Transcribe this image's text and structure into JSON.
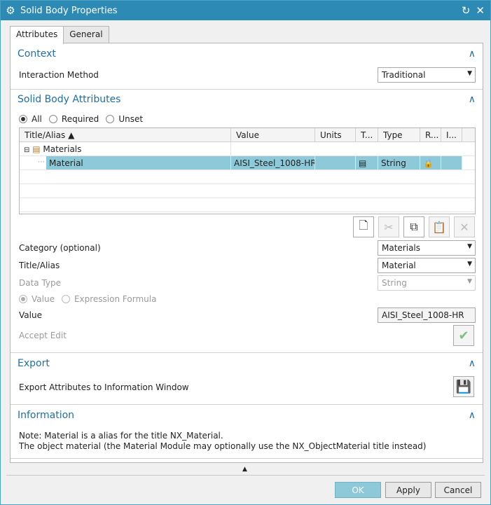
{
  "window": {
    "title": "Solid Body Properties"
  },
  "tabs": [
    {
      "label": "Attributes"
    },
    {
      "label": "General"
    }
  ],
  "context": {
    "header": "Context",
    "interaction_label": "Interaction Method",
    "interaction_value": "Traditional"
  },
  "attributes": {
    "header": "Solid Body Attributes",
    "filter": {
      "all": "All",
      "required": "Required",
      "unset": "Unset",
      "selected": "All"
    },
    "table": {
      "columns": [
        "Title/Alias",
        "Value",
        "Units",
        "T...",
        "Type",
        "R...",
        "I..."
      ],
      "group": "Materials",
      "row": {
        "title": "Material",
        "value": "AISI_Steel_1008-HR",
        "units": "",
        "type": "String"
      }
    },
    "category_label": "Category (optional)",
    "category_value": "Materials",
    "title_label": "Title/Alias",
    "title_value": "Material",
    "datatype_label": "Data Type",
    "datatype_value": "String",
    "mode": {
      "value": "Value",
      "formula": "Expression Formula"
    },
    "value_label": "Value",
    "value_value": "AISI_Steel_1008-HR",
    "accept_label": "Accept Edit"
  },
  "export": {
    "header": "Export",
    "label": "Export Attributes to Information Window"
  },
  "information": {
    "header": "Information",
    "line1": "Note: Material is a alias for the title NX_Material.",
    "line2": "The object material (the Material Module may optionally use the NX_ObjectMaterial title instead)"
  },
  "buttons": {
    "ok": "OK",
    "apply": "Apply",
    "cancel": "Cancel"
  }
}
